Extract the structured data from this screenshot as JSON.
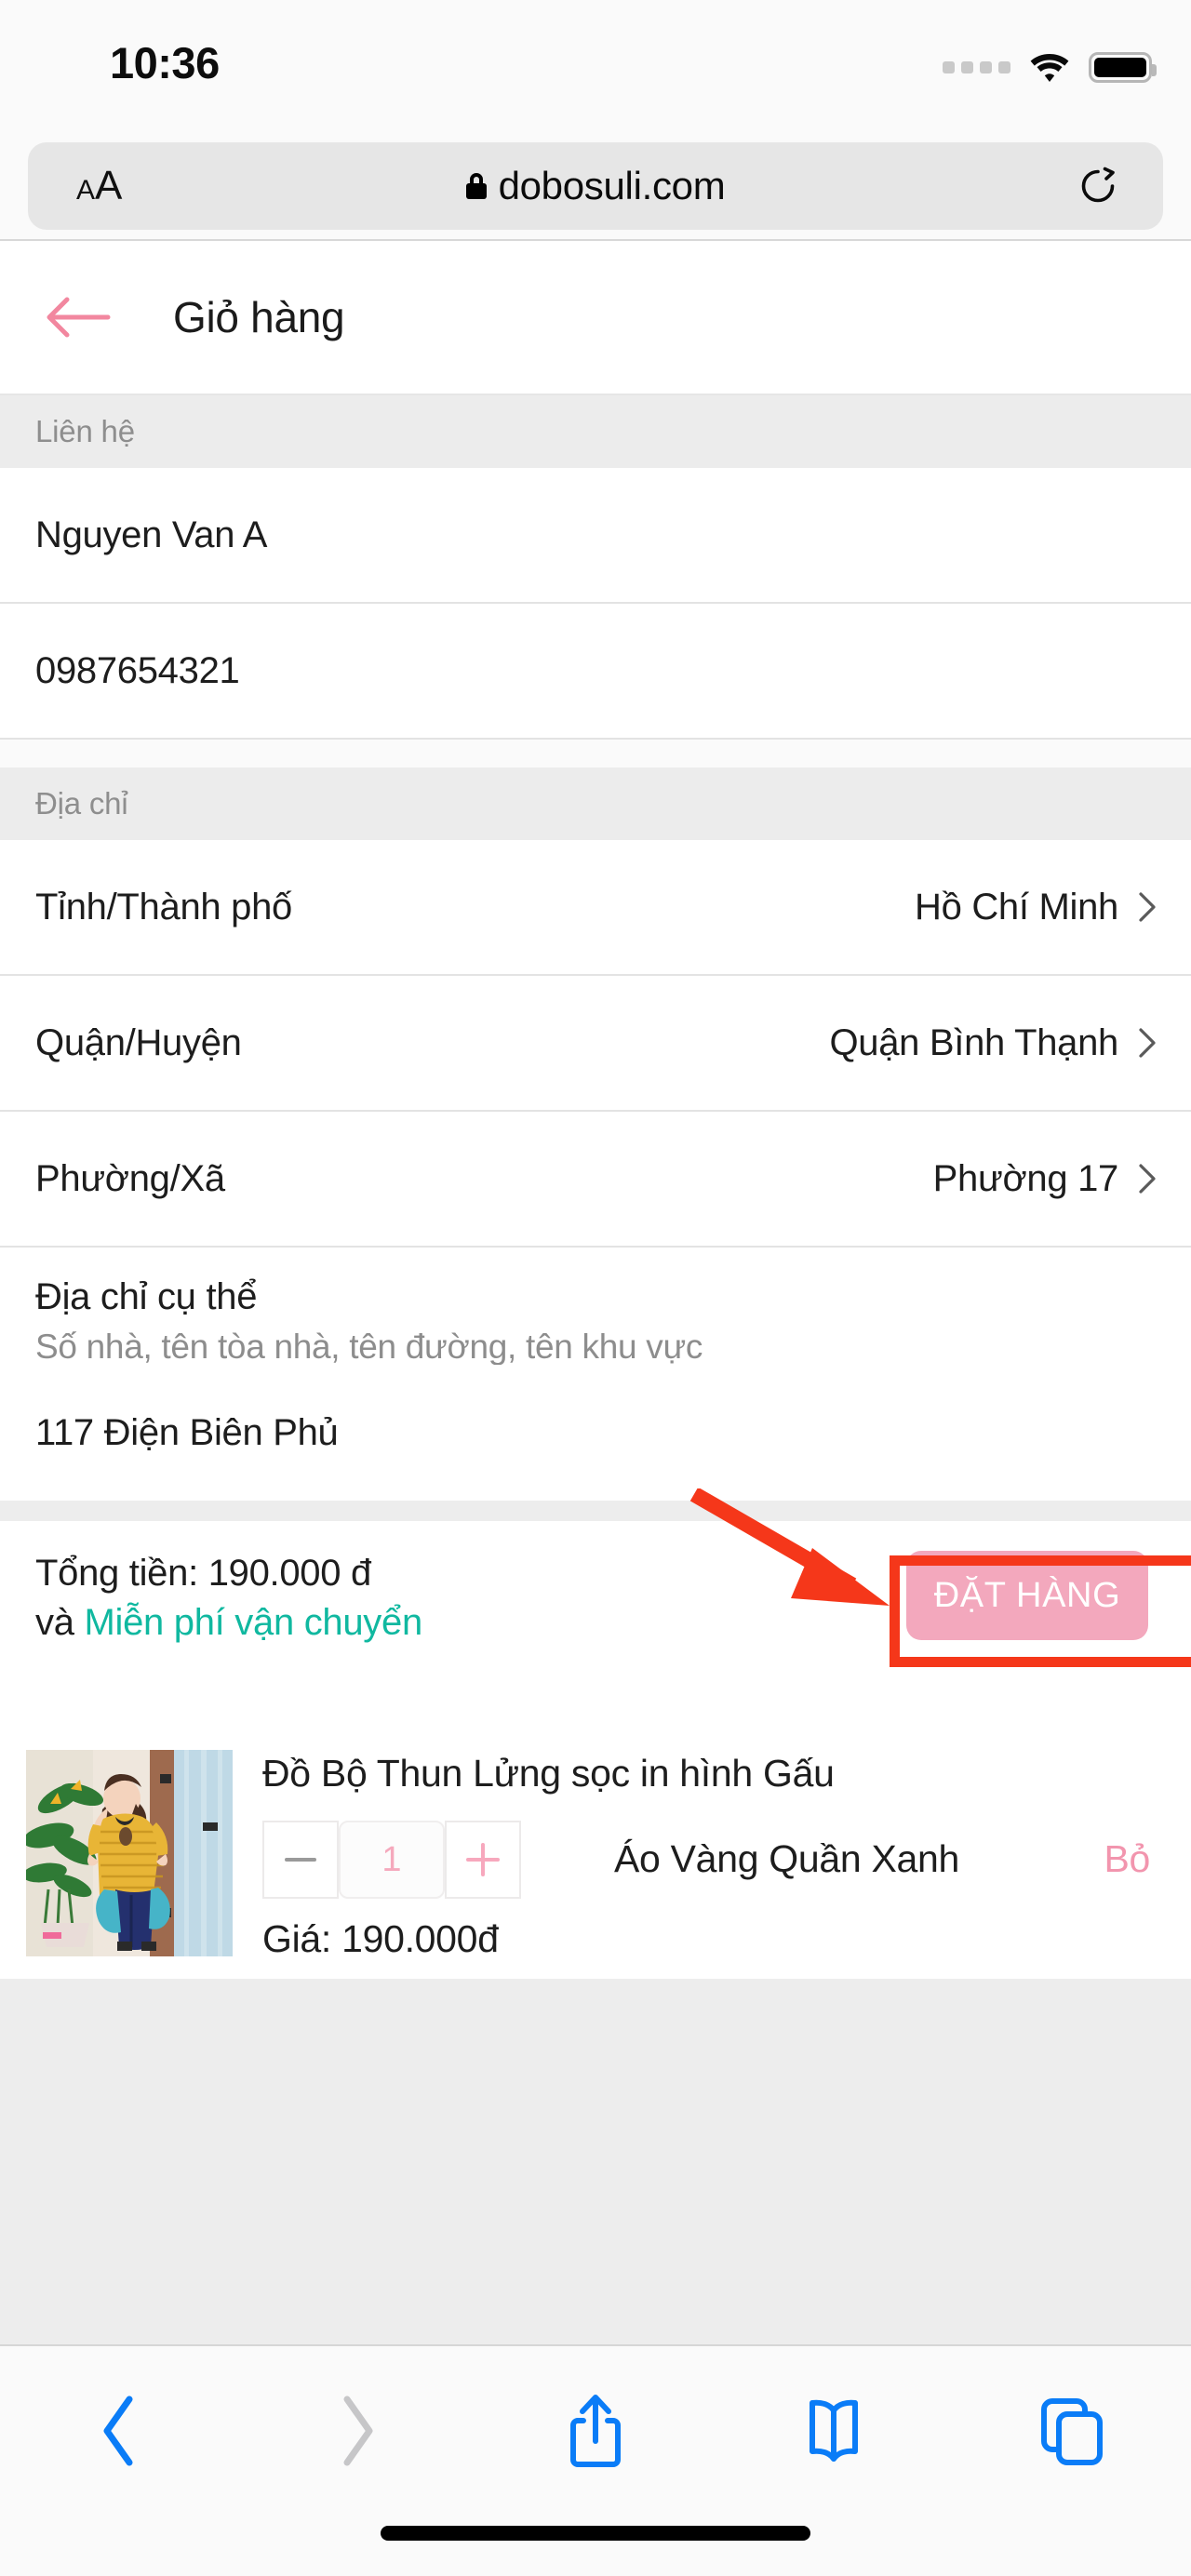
{
  "status_bar": {
    "time": "10:36",
    "signal_icon": "signal-dots-icon",
    "wifi_icon": "wifi-icon",
    "battery_icon": "battery-full-icon"
  },
  "browser": {
    "text_size_label": "AA",
    "lock_icon": "lock-icon",
    "url": "dobosuli.com",
    "reload_icon": "reload-icon",
    "toolbar": {
      "back_icon": "chevron-left-icon",
      "forward_icon": "chevron-right-icon",
      "share_icon": "share-icon",
      "bookmarks_icon": "book-icon",
      "tabs_icon": "tabs-icon"
    }
  },
  "page": {
    "back_icon": "arrow-left-icon",
    "title": "Giỏ hàng"
  },
  "contact": {
    "section_label": "Liên hệ",
    "name": "Nguyen Van A",
    "phone": "0987654321"
  },
  "address": {
    "section_label": "Địa chỉ",
    "rows": [
      {
        "label": "Tỉnh/Thành phố",
        "value": "Hồ Chí Minh"
      },
      {
        "label": "Quận/Huyện",
        "value": "Quận Bình Thạnh"
      },
      {
        "label": "Phường/Xã",
        "value": "Phường 17"
      }
    ],
    "detail_title": "Địa chỉ cụ thể",
    "detail_hint": "Số nhà, tên tòa nhà, tên đường, tên khu vực",
    "detail_value": "117 Điện Biên Phủ"
  },
  "summary": {
    "total_label": "Tổng tiền: 190.000 đ",
    "shipping_prefix": "và ",
    "shipping_text": "Miễn phí vận chuyển",
    "order_button": "ĐẶT HÀNG"
  },
  "cart_item": {
    "name": "Đồ Bộ Thun Lửng sọc in hình Gấu",
    "quantity": "1",
    "decrease_icon": "minus-icon",
    "increase_icon": "plus-icon",
    "variant": "Áo Vàng Quần Xanh",
    "remove_label": "Bỏ",
    "price": "Giá: 190.000đ",
    "thumbnail_alt": "product-photo-woman-yellow-striped-top"
  },
  "annotation": {
    "highlight_color": "#f5371a",
    "arrow_icon": "red-arrow-icon",
    "target": "ĐẶT HÀNG"
  },
  "colors": {
    "accent_pink": "#f3a8bd",
    "link_teal": "#10b8a0",
    "safari_blue": "#0a7cf7",
    "section_grey": "#ececec"
  }
}
